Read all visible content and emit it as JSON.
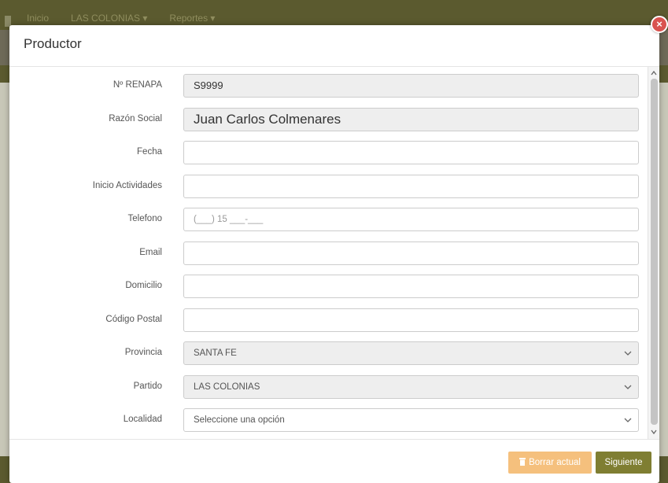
{
  "background": {
    "nav": [
      "Inicio",
      "LAS COLONIAS ▾",
      "Reportes ▾"
    ]
  },
  "modal": {
    "title": "Productor",
    "close_label": "×",
    "fields": [
      {
        "label": "Nº RENAPA",
        "value": "S9999",
        "readonly": true
      },
      {
        "label": "Razón Social",
        "value": "Juan Carlos Colmenares",
        "readonly": true
      },
      {
        "label": "Fecha",
        "value": ""
      },
      {
        "label": "Inicio Actividades",
        "value": ""
      },
      {
        "label": "Telefono",
        "value": "",
        "placeholder": "(___) 15 ___-___"
      },
      {
        "label": "Email",
        "value": ""
      },
      {
        "label": "Domicilio",
        "value": ""
      },
      {
        "label": "Código Postal",
        "value": ""
      },
      {
        "label": "Provincia",
        "value": "SANTA FE",
        "type": "select",
        "readonly": true
      },
      {
        "label": "Partido",
        "value": "LAS COLONIAS",
        "type": "select",
        "readonly": true
      },
      {
        "label": "Localidad",
        "value": "Seleccione una opción",
        "type": "select"
      }
    ],
    "footer": {
      "clear_label": "Borrar actual",
      "next_label": "Siguiente"
    }
  },
  "colors": {
    "primary": "#7f7e32",
    "warning": "#f5c07d",
    "danger": "#d9534f"
  }
}
